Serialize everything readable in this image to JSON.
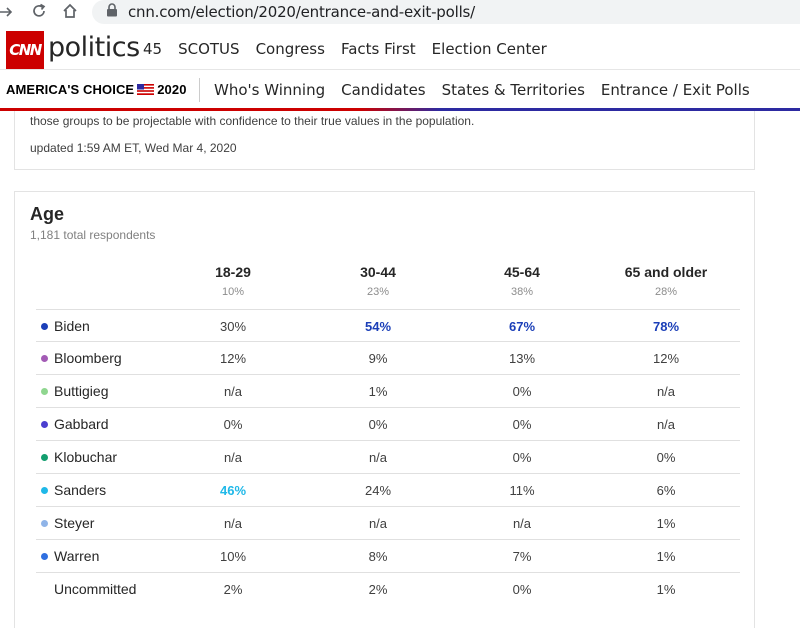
{
  "browser": {
    "url": "cnn.com/election/2020/entrance-and-exit-polls/"
  },
  "header": {
    "logo_text": "CNN",
    "section": "politics",
    "nav": [
      "45",
      "SCOTUS",
      "Congress",
      "Facts First",
      "Election Center"
    ]
  },
  "subnav": {
    "brand": "AMERICA'S CHOICE",
    "brand_year": "2020",
    "items": [
      "Who's Winning",
      "Candidates",
      "States & Territories",
      "Entrance / Exit Polls"
    ]
  },
  "methodology": {
    "text": "those groups to be projectable with confidence to their true values in the population.",
    "updated": "updated 1:59 AM ET, Wed Mar 4, 2020"
  },
  "age_table": {
    "title": "Age",
    "respondents": "1,181 total respondents",
    "columns": [
      {
        "label": "18-29",
        "share": "10%"
      },
      {
        "label": "30-44",
        "share": "23%"
      },
      {
        "label": "45-64",
        "share": "38%"
      },
      {
        "label": "65 and older",
        "share": "28%"
      }
    ],
    "rows": [
      {
        "name": "Biden",
        "color": "#1b3fb8",
        "values": [
          "30%",
          "54%",
          "67%",
          "78%"
        ],
        "winners": [
          false,
          true,
          true,
          true
        ]
      },
      {
        "name": "Bloomberg",
        "color": "#a35bb5",
        "values": [
          "12%",
          "9%",
          "13%",
          "12%"
        ],
        "winners": [
          false,
          false,
          false,
          false
        ]
      },
      {
        "name": "Buttigieg",
        "color": "#8fd68f",
        "values": [
          "n/a",
          "1%",
          "0%",
          "n/a"
        ],
        "winners": [
          false,
          false,
          false,
          false
        ]
      },
      {
        "name": "Gabbard",
        "color": "#4b3fcf",
        "values": [
          "0%",
          "0%",
          "0%",
          "n/a"
        ],
        "winners": [
          false,
          false,
          false,
          false
        ]
      },
      {
        "name": "Klobuchar",
        "color": "#129e6e",
        "values": [
          "n/a",
          "n/a",
          "0%",
          "0%"
        ],
        "winners": [
          false,
          false,
          false,
          false
        ]
      },
      {
        "name": "Sanders",
        "color": "#1fb8e8",
        "values": [
          "46%",
          "24%",
          "11%",
          "6%"
        ],
        "winners": [
          true,
          false,
          false,
          false
        ]
      },
      {
        "name": "Steyer",
        "color": "#8fb4e8",
        "values": [
          "n/a",
          "n/a",
          "n/a",
          "1%"
        ],
        "winners": [
          false,
          false,
          false,
          false
        ]
      },
      {
        "name": "Warren",
        "color": "#2f6fe0",
        "values": [
          "10%",
          "8%",
          "7%",
          "1%"
        ],
        "winners": [
          false,
          false,
          false,
          false
        ]
      },
      {
        "name": "Uncommitted",
        "color": "",
        "values": [
          "2%",
          "2%",
          "0%",
          "1%"
        ],
        "winners": [
          false,
          false,
          false,
          false
        ]
      }
    ]
  }
}
